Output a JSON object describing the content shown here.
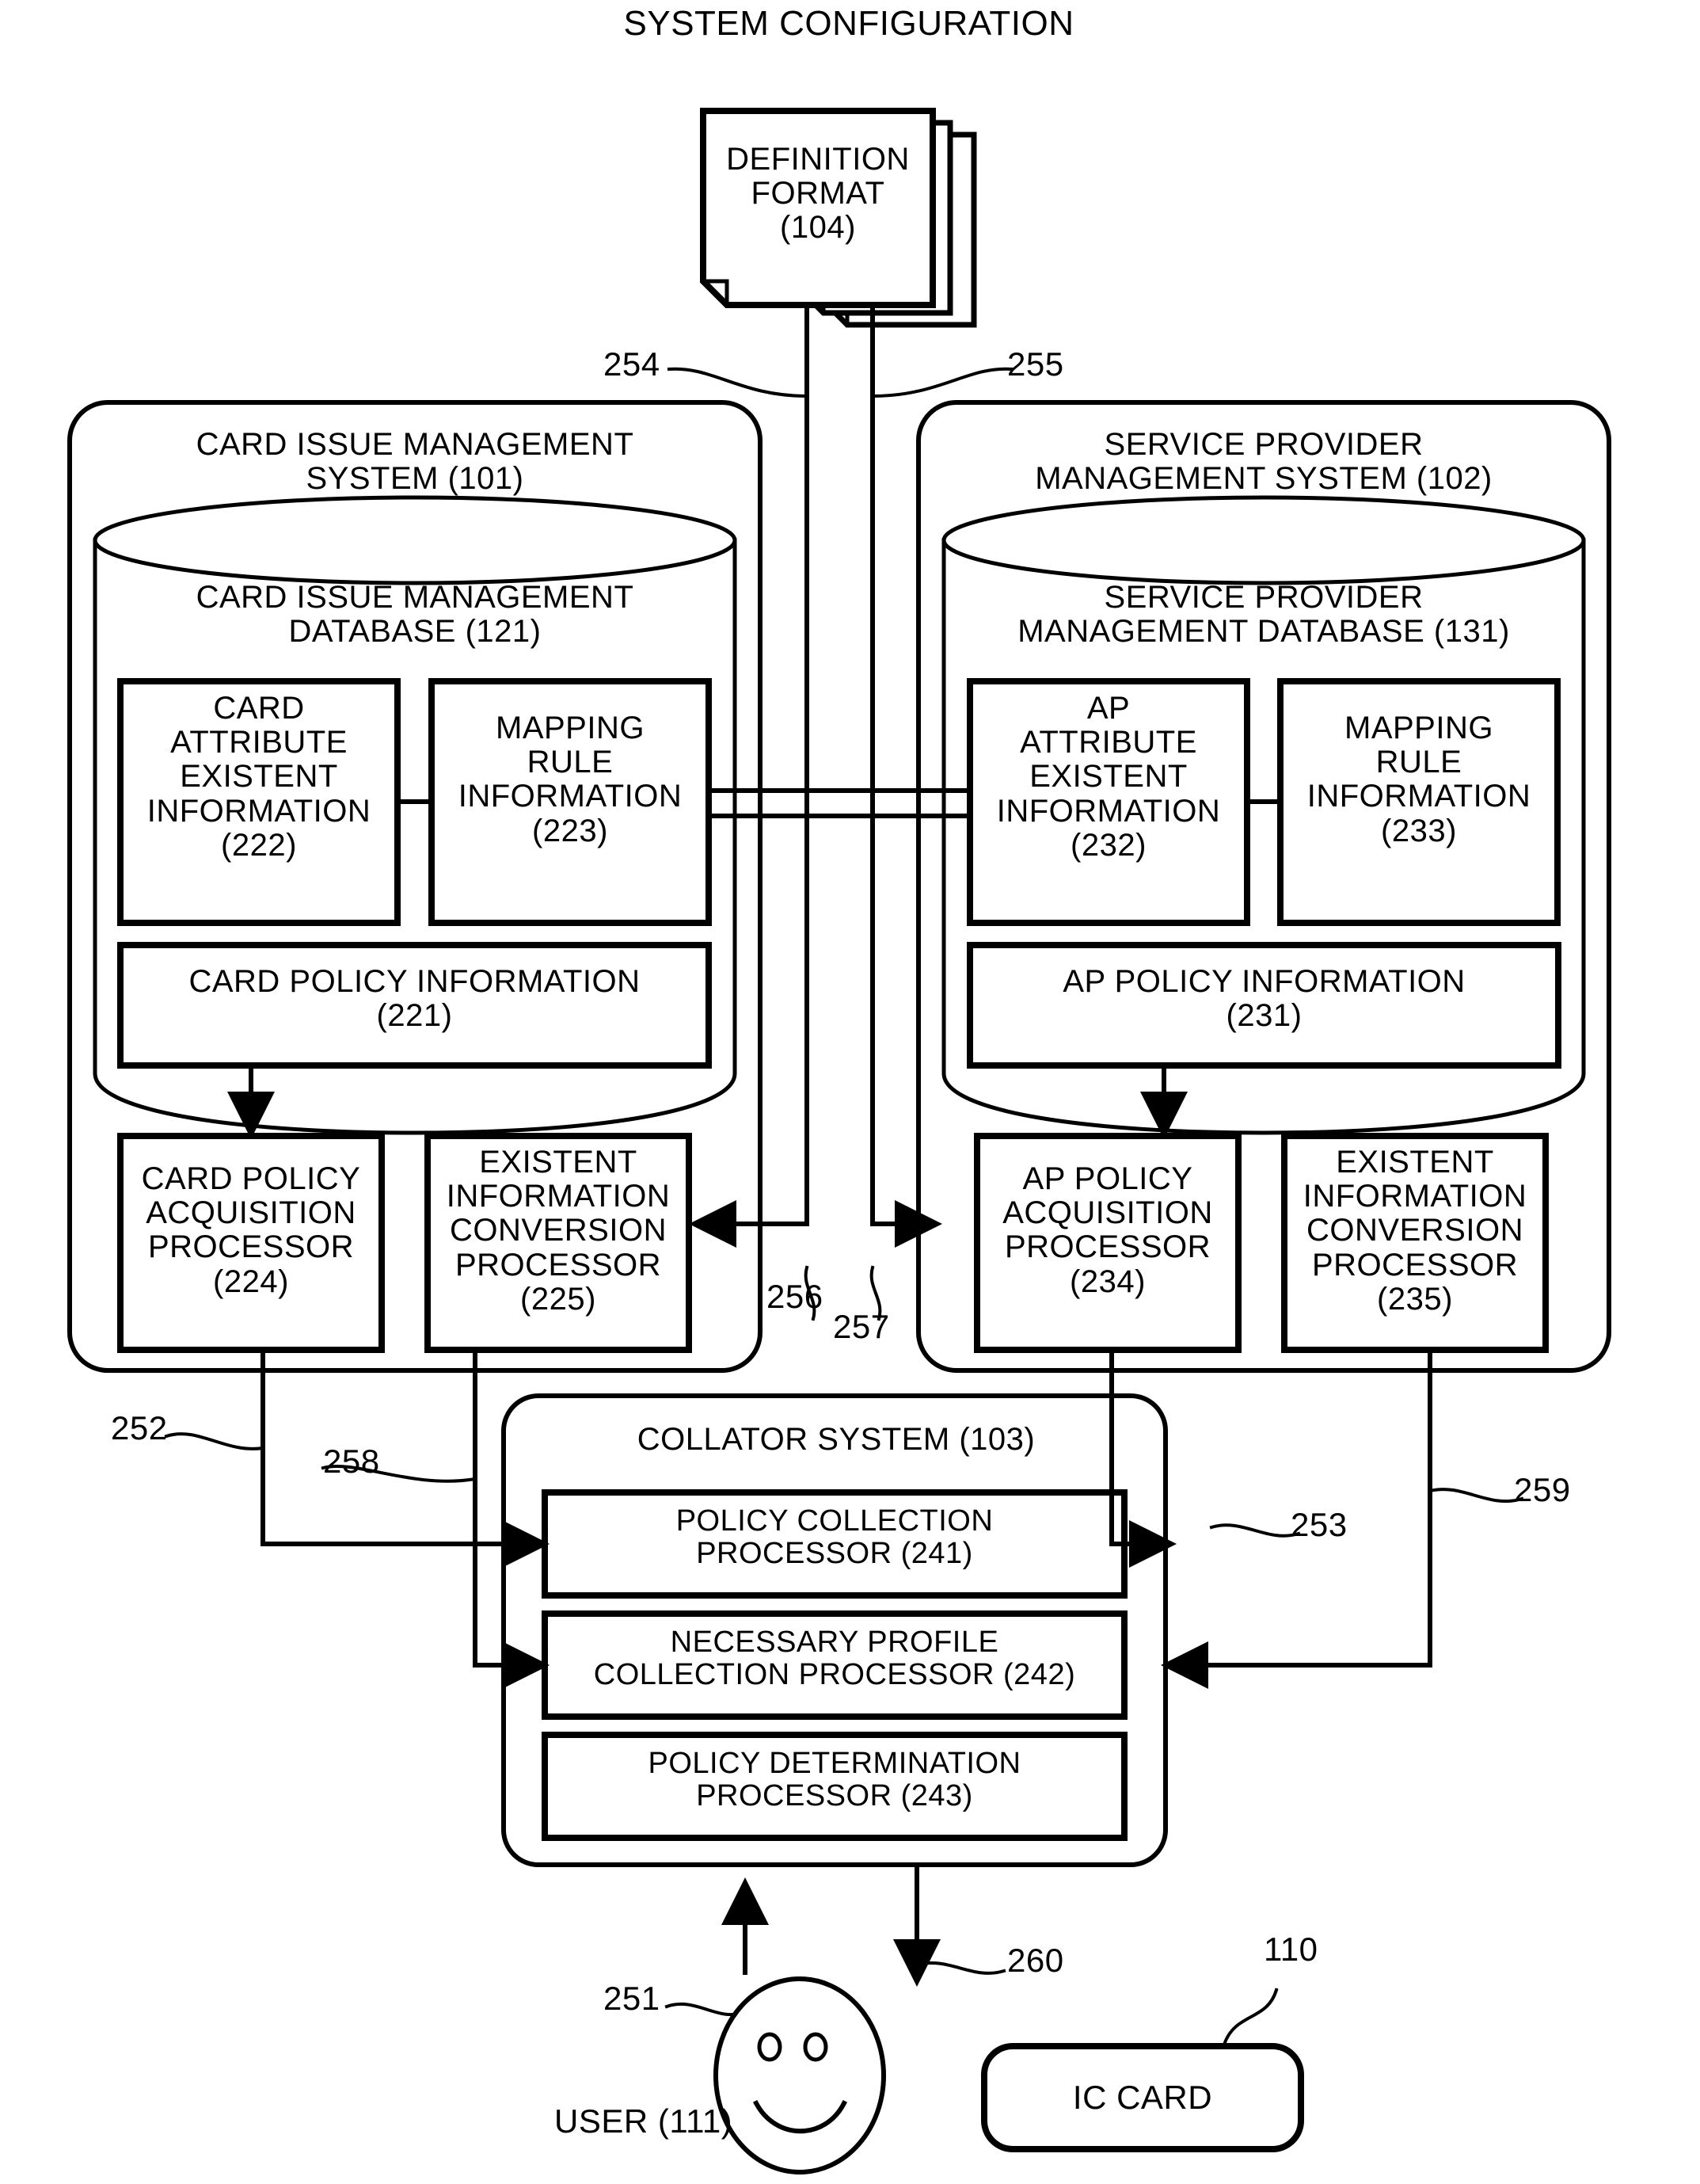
{
  "figure": {
    "title": "SYSTEM CONFIGURATION",
    "type": "patent-system-block-diagram"
  },
  "definition_format": {
    "label": "DEFINITION\nFORMAT\n(104)",
    "ref": "104",
    "stack_count": 3
  },
  "left_system": {
    "title": "CARD ISSUE MANAGEMENT\nSYSTEM (101)",
    "ref": "101",
    "database": {
      "title": "CARD ISSUE MANAGEMENT\nDATABASE (121)",
      "ref": "121",
      "items": [
        {
          "label": "CARD\nATTRIBUTE\nEXISTENT\nINFORMATION\n(222)",
          "ref": "222"
        },
        {
          "label": "MAPPING\nRULE\nINFORMATION\n(223)",
          "ref": "223"
        },
        {
          "label": "CARD POLICY INFORMATION\n(221)",
          "ref": "221"
        }
      ]
    },
    "processors": [
      {
        "label": "CARD POLICY\nACQUISITION\nPROCESSOR\n(224)",
        "ref": "224"
      },
      {
        "label": "EXISTENT\nINFORMATION\nCONVERSION\nPROCESSOR\n(225)",
        "ref": "225"
      }
    ]
  },
  "right_system": {
    "title": "SERVICE PROVIDER\nMANAGEMENT SYSTEM (102)",
    "ref": "102",
    "database": {
      "title": "SERVICE PROVIDER\nMANAGEMENT DATABASE (131)",
      "ref": "131",
      "items": [
        {
          "label": "AP\nATTRIBUTE\nEXISTENT\nINFORMATION\n(232)",
          "ref": "232"
        },
        {
          "label": "MAPPING\nRULE\nINFORMATION\n(233)",
          "ref": "233"
        },
        {
          "label": "AP POLICY INFORMATION\n(231)",
          "ref": "231"
        }
      ]
    },
    "processors": [
      {
        "label": "AP POLICY\nACQUISITION\nPROCESSOR\n(234)",
        "ref": "234"
      },
      {
        "label": "EXISTENT\nINFORMATION\nCONVERSION\nPROCESSOR\n(235)",
        "ref": "235"
      }
    ]
  },
  "collator_system": {
    "title": "COLLATOR SYSTEM (103)",
    "ref": "103",
    "processors": [
      {
        "label": "POLICY COLLECTION\nPROCESSOR (241)",
        "ref": "241"
      },
      {
        "label": "NECESSARY PROFILE\nCOLLECTION PROCESSOR (242)",
        "ref": "242"
      },
      {
        "label": "POLICY DETERMINATION\nPROCESSOR (243)",
        "ref": "243"
      }
    ]
  },
  "actors": {
    "user": {
      "label": "USER (111)",
      "ref": "111",
      "icon": "smiley-face"
    },
    "ic_card": {
      "label": "IC CARD",
      "ref": "110"
    }
  },
  "connector_refs": {
    "r251": "251",
    "r252": "252",
    "r253": "253",
    "r254": "254",
    "r255": "255",
    "r256": "256",
    "r257": "257",
    "r258": "258",
    "r259": "259",
    "r260": "260",
    "r110": "110"
  },
  "colors": {
    "ink": "#000000",
    "paper": "#ffffff"
  }
}
